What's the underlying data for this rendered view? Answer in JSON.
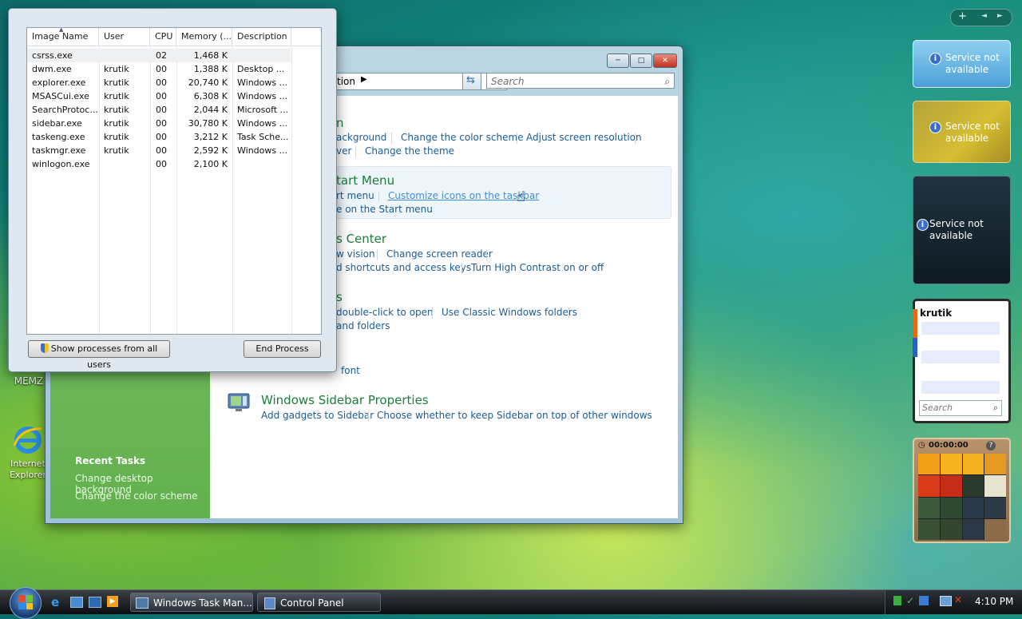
{
  "desktop": {
    "icons": [
      {
        "label": "MEMZ"
      },
      {
        "label": "Internet\nExplorer"
      }
    ]
  },
  "sidebar_controls": {
    "add": "+",
    "prev": "◄",
    "next": "►"
  },
  "control_panel": {
    "search_placeholder": "Search",
    "address_fragment": "tion",
    "sections": [
      {
        "heading": "n",
        "links": [
          "ackground",
          "Change the color scheme",
          "Adjust screen resolution",
          "ver",
          "Change the theme"
        ]
      },
      {
        "heading": "tart Menu",
        "links": [
          "rt menu",
          "Customize icons on the taskbar",
          "e on the Start menu"
        ]
      },
      {
        "heading": "s Center",
        "links": [
          "w vision",
          "Change screen reader",
          "d shortcuts and access keys",
          "Turn High Contrast on or off"
        ]
      },
      {
        "heading": "s",
        "links": [
          "double-click to open",
          "Use Classic Windows folders",
          "and folders"
        ]
      },
      {
        "heading": "",
        "links": [
          "font"
        ]
      },
      {
        "heading": "Windows Sidebar Properties",
        "links": [
          "Add gadgets to Sidebar",
          "Choose whether to keep Sidebar on top of other windows"
        ]
      }
    ],
    "recent_tasks": {
      "title": "Recent Tasks",
      "items": [
        "Change desktop background",
        "Change the color scheme"
      ]
    }
  },
  "task_manager": {
    "columns": [
      "Image Name",
      "User Name",
      "CPU",
      "Memory (...",
      "Description"
    ],
    "rows": [
      {
        "name": "csrss.exe",
        "user": "",
        "cpu": "02",
        "mem": "1,468 K",
        "desc": ""
      },
      {
        "name": "dwm.exe",
        "user": "krutik",
        "cpu": "00",
        "mem": "1,388 K",
        "desc": "Desktop ..."
      },
      {
        "name": "explorer.exe",
        "user": "krutik",
        "cpu": "00",
        "mem": "20,740 K",
        "desc": "Windows ..."
      },
      {
        "name": "MSASCui.exe",
        "user": "krutik",
        "cpu": "00",
        "mem": "6,308 K",
        "desc": "Windows ..."
      },
      {
        "name": "SearchProtoc...",
        "user": "krutik",
        "cpu": "00",
        "mem": "2,044 K",
        "desc": "Microsoft ..."
      },
      {
        "name": "sidebar.exe",
        "user": "krutik",
        "cpu": "00",
        "mem": "30,780 K",
        "desc": "Windows ..."
      },
      {
        "name": "taskeng.exe",
        "user": "krutik",
        "cpu": "00",
        "mem": "3,212 K",
        "desc": "Task Sche..."
      },
      {
        "name": "taskmgr.exe",
        "user": "krutik",
        "cpu": "00",
        "mem": "2,592 K",
        "desc": "Windows ..."
      },
      {
        "name": "winlogon.exe",
        "user": "",
        "cpu": "00",
        "mem": "2,100 K",
        "desc": ""
      }
    ],
    "show_all_label": "Show processes from all users",
    "end_process_label": "End Process"
  },
  "gadgets": {
    "weather_msg": "Service not available",
    "clock_msg": "Service not available",
    "feed_msg": "Service not available",
    "contacts_user": "krutik",
    "contacts_search": "Search",
    "puzzle_timer": "00:00:00",
    "puzzle_help": "?"
  },
  "taskbar": {
    "buttons": [
      "Windows Task Man...",
      "Control Panel"
    ],
    "clock": "4:10 PM"
  },
  "colors": {
    "accent": "#1a5d94",
    "heading": "#1b7d38"
  }
}
